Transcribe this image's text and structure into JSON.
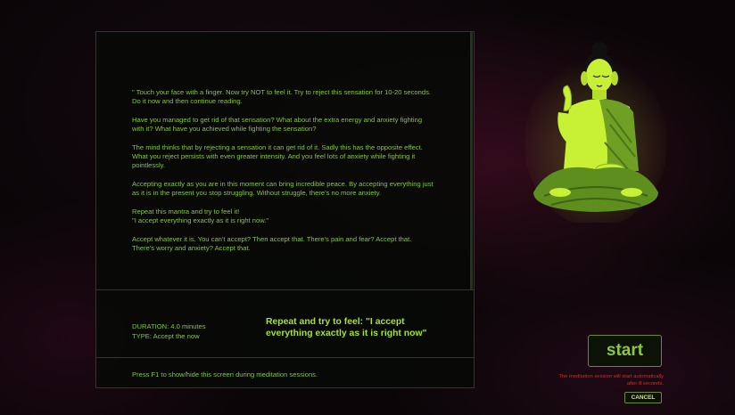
{
  "article": {
    "paragraphs": [
      "\" Touch your face with a finger. Now try NOT to feel it. Try to reject this sensation for 10-20 seconds.\nDo it now and then continue reading.",
      "Have you managed to get rid of that sensation? What about the extra energy and anxiety fighting with it? What have you achieved while fighting the sensation?",
      "The mind thinks that by rejecting a sensation it can get rid of it. Sadly this has the opposite effect. What you reject persists with even greater intensity. And you feel lots of anxiety while fighting it pointlessly.",
      "Accepting exactly as you are in this moment can bring incredible peace. By accepting everything just as it is in the present you stop struggling. Without struggle, there's no more anxiety.",
      "Repeat this mantra and try to feel it!\n\"I accept everything exactly as it is right now.\"",
      "Accept whatever it is. You can't accept? Then accept that. There's pain and fear? Accept that. There's worry and anxiety? Accept that."
    ]
  },
  "session": {
    "duration": "DURATION: 4.0 minutes",
    "type": "TYPE: Accept the now",
    "mantra": "Repeat and try to feel: \"I accept everything exactly as it is right now\""
  },
  "hint": "Press F1 to show/hide this screen during meditation sessions.",
  "controls": {
    "start_label": "start",
    "countdown": "The meditation session will start automatically after 8 seconds.",
    "cancel_label": "CANCEL"
  },
  "colors": {
    "text": "#86c53a",
    "accent": "#a6e22e",
    "warning": "#e0261c",
    "buddha_glow": "#c8f035"
  },
  "icons": {
    "figure": "meditating-buddha-icon"
  }
}
